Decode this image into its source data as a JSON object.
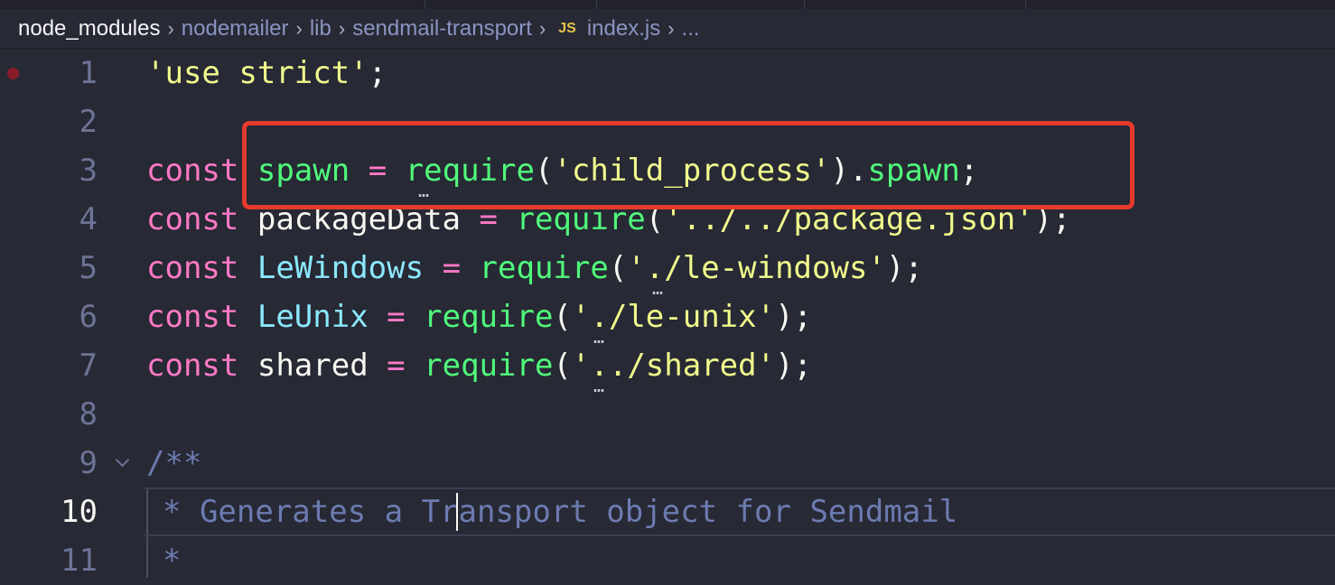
{
  "breadcrumb": {
    "items": [
      "node_modules",
      "nodemailer",
      "lib",
      "sendmail-transport"
    ],
    "file_badge": "JS",
    "file": "index.js",
    "more": "..."
  },
  "gutter": {
    "line_numbers": [
      "1",
      "2",
      "3",
      "4",
      "5",
      "6",
      "7",
      "8",
      "9",
      "10",
      "11"
    ],
    "active_line": "10"
  },
  "code": {
    "l1": {
      "str": "'use strict'",
      "punct": ";"
    },
    "l3": {
      "kw": "const",
      "id": "spawn",
      "op": "=",
      "fn": "require",
      "p1": "(",
      "str": "'child_process'",
      "p2": ").",
      "prop": "spawn",
      "end": ";"
    },
    "l4": {
      "kw": "const",
      "id": "packageData",
      "op": "=",
      "fn": "require",
      "p1": "(",
      "str": "'../../package.json'",
      "end": ");"
    },
    "l5": {
      "kw": "const",
      "id": "LeWindows",
      "op": "=",
      "fn": "require",
      "p1": "(",
      "str": "'./le-windows'",
      "end": ");"
    },
    "l6": {
      "kw": "const",
      "id": "LeUnix",
      "op": "=",
      "fn": "require",
      "p1": "(",
      "str": "'./le-unix'",
      "end": ");"
    },
    "l7": {
      "kw": "const",
      "id": "shared",
      "op": "=",
      "fn": "require",
      "p1": "(",
      "str": "'../shared'",
      "end": ");"
    },
    "l9": {
      "comment": "/**"
    },
    "l10": {
      "comment": "* Generates a Transport object for Sendmail"
    },
    "l11": {
      "comment": "*"
    }
  },
  "colors": {
    "background": "#272935",
    "keyword": "#ff79c6",
    "function": "#50fa7b",
    "string": "#f1fa8c",
    "class": "#8be9fd",
    "comment": "#6c7bb0",
    "highlight_box": "#e53b2c"
  }
}
